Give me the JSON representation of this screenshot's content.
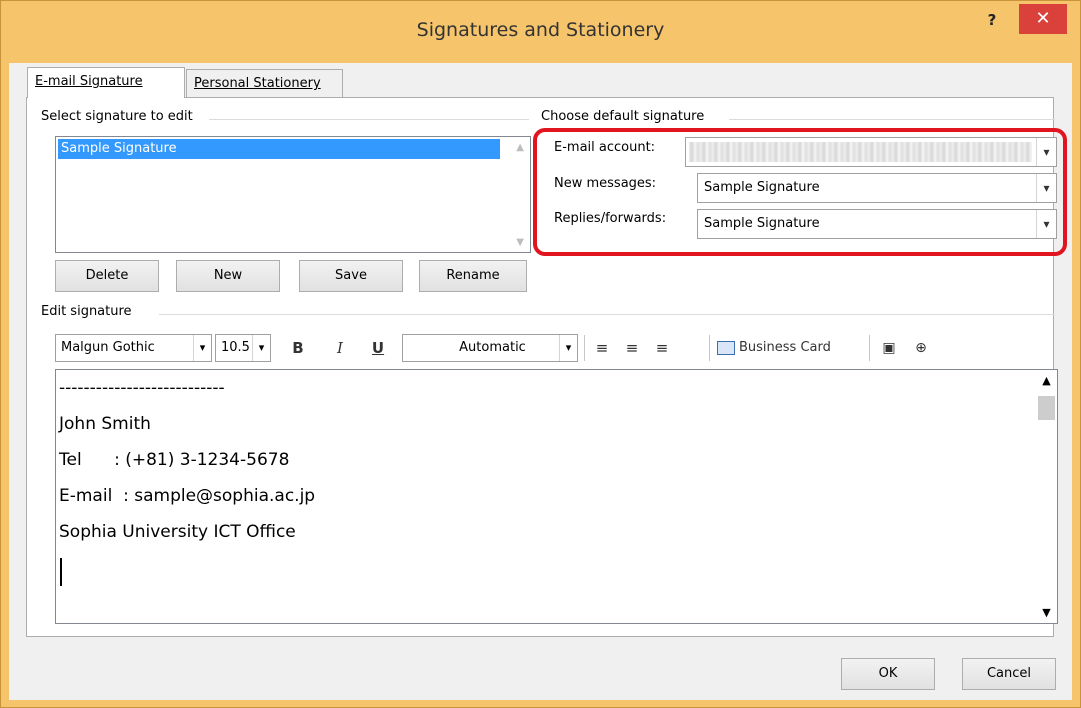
{
  "window": {
    "title": "Signatures and Stationery",
    "help": "?",
    "close": "✕"
  },
  "tabs": [
    {
      "label": "E-mail Signature"
    },
    {
      "label": "Personal Stationery"
    }
  ],
  "select_signature": {
    "group_label": "Select signature to edit",
    "items": [
      "Sample Signature"
    ]
  },
  "buttons": {
    "delete": "Delete",
    "new": "New",
    "save": "Save",
    "rename": "Rename"
  },
  "default_signature": {
    "group_label": "Choose default signature",
    "email_account_label": "E-mail account:",
    "email_account_value": "",
    "new_messages_label": "New messages:",
    "new_messages_value": "Sample Signature",
    "replies_label": "Replies/forwards:",
    "replies_value": "Sample Signature"
  },
  "edit_signature": {
    "group_label": "Edit signature",
    "font": "Malgun Gothic",
    "size": "10.5",
    "bold": "B",
    "italic": "I",
    "underline": "U",
    "color": "Automatic",
    "business_card": "Business Card",
    "lines": [
      "---------------------------",
      "John Smith",
      "Tel      : (+81) 3-1234-5678",
      "E-mail  : sample@sophia.ac.jp",
      "Sophia University ICT Office"
    ]
  },
  "footer": {
    "ok": "OK",
    "cancel": "Cancel"
  },
  "colors": {
    "title_bar": "#f5c46b",
    "close_button": "#d9413a",
    "selection": "#3399ff",
    "highlight_box": "#e0151f"
  }
}
